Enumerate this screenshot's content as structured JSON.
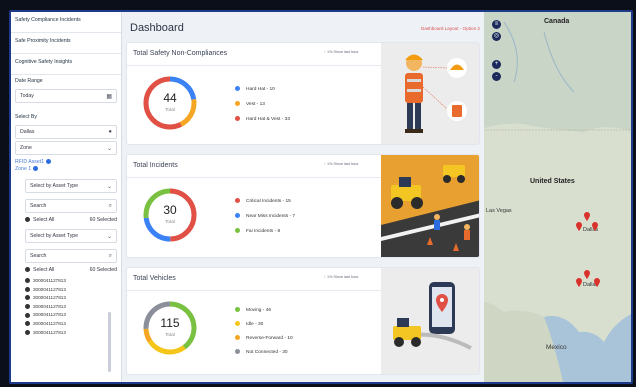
{
  "sidebar": {
    "tabs": [
      "Safety Compliance Incidents",
      "Safe Proximity Incidents",
      "Cognitive Safety Insights"
    ],
    "date_range_label": "Date Range",
    "date_value": "Today",
    "select_by_label": "Select By",
    "city_value": "Dallas",
    "zone_value": "Zone",
    "filter_1": "RFID Asset1",
    "filter_2": "Zone 1",
    "asset_type_placeholder": "Select by Asset Type",
    "search_placeholder": "Search",
    "select_all": "Select All",
    "selected_count": "60 Selected",
    "asset_type_placeholder_2": "Select by Asset Type",
    "search_placeholder_2": "Search",
    "select_all_2": "Select All",
    "selected_count_2": "60 Selected",
    "asset_ids": [
      "3000041127813",
      "3000041127813",
      "3000041127813",
      "3000041127813",
      "3000041127813",
      "3000041127813",
      "3000041127813"
    ]
  },
  "main": {
    "title": "Dashboard",
    "layout_link": "Dashboard Layout - Option 2",
    "cards": [
      {
        "title": "Total Safety Non-Compliances",
        "note": "1% Since last hour",
        "total": "44",
        "total_label": "Total",
        "legend": [
          {
            "label": "Hard Hat - 10",
            "color": "#3b82f6"
          },
          {
            "label": "Vest - 13",
            "color": "#f5a623"
          },
          {
            "label": "Hard Hat & Vest - 33",
            "color": "#e05045"
          }
        ]
      },
      {
        "title": "Total Incidents",
        "note": "1% Since last hour",
        "total": "30",
        "total_label": "Total",
        "legend": [
          {
            "label": "Critical Incidents - 15",
            "color": "#e05045"
          },
          {
            "label": "Near Miss Incidents - 7",
            "color": "#3b82f6"
          },
          {
            "label": "Fai Incidents - 8",
            "color": "#7ac142"
          }
        ]
      },
      {
        "title": "Total Vehicles",
        "note": "1% Since last hour",
        "total": "115",
        "total_label": "Total",
        "legend": [
          {
            "label": "Moving - 46",
            "color": "#7ac142"
          },
          {
            "label": "Idle - 30",
            "color": "#f5c518"
          },
          {
            "label": "Reverse-Forward - 10",
            "color": "#f5a623"
          },
          {
            "label": "Not Connected - 30",
            "color": "#8a8f99"
          }
        ]
      }
    ]
  },
  "map": {
    "labels": [
      "Canada",
      "United States",
      "Las Vegas",
      "Dallas",
      "Dallas",
      "Mexico"
    ],
    "zoom_in": "+",
    "zoom_out": "-"
  }
}
